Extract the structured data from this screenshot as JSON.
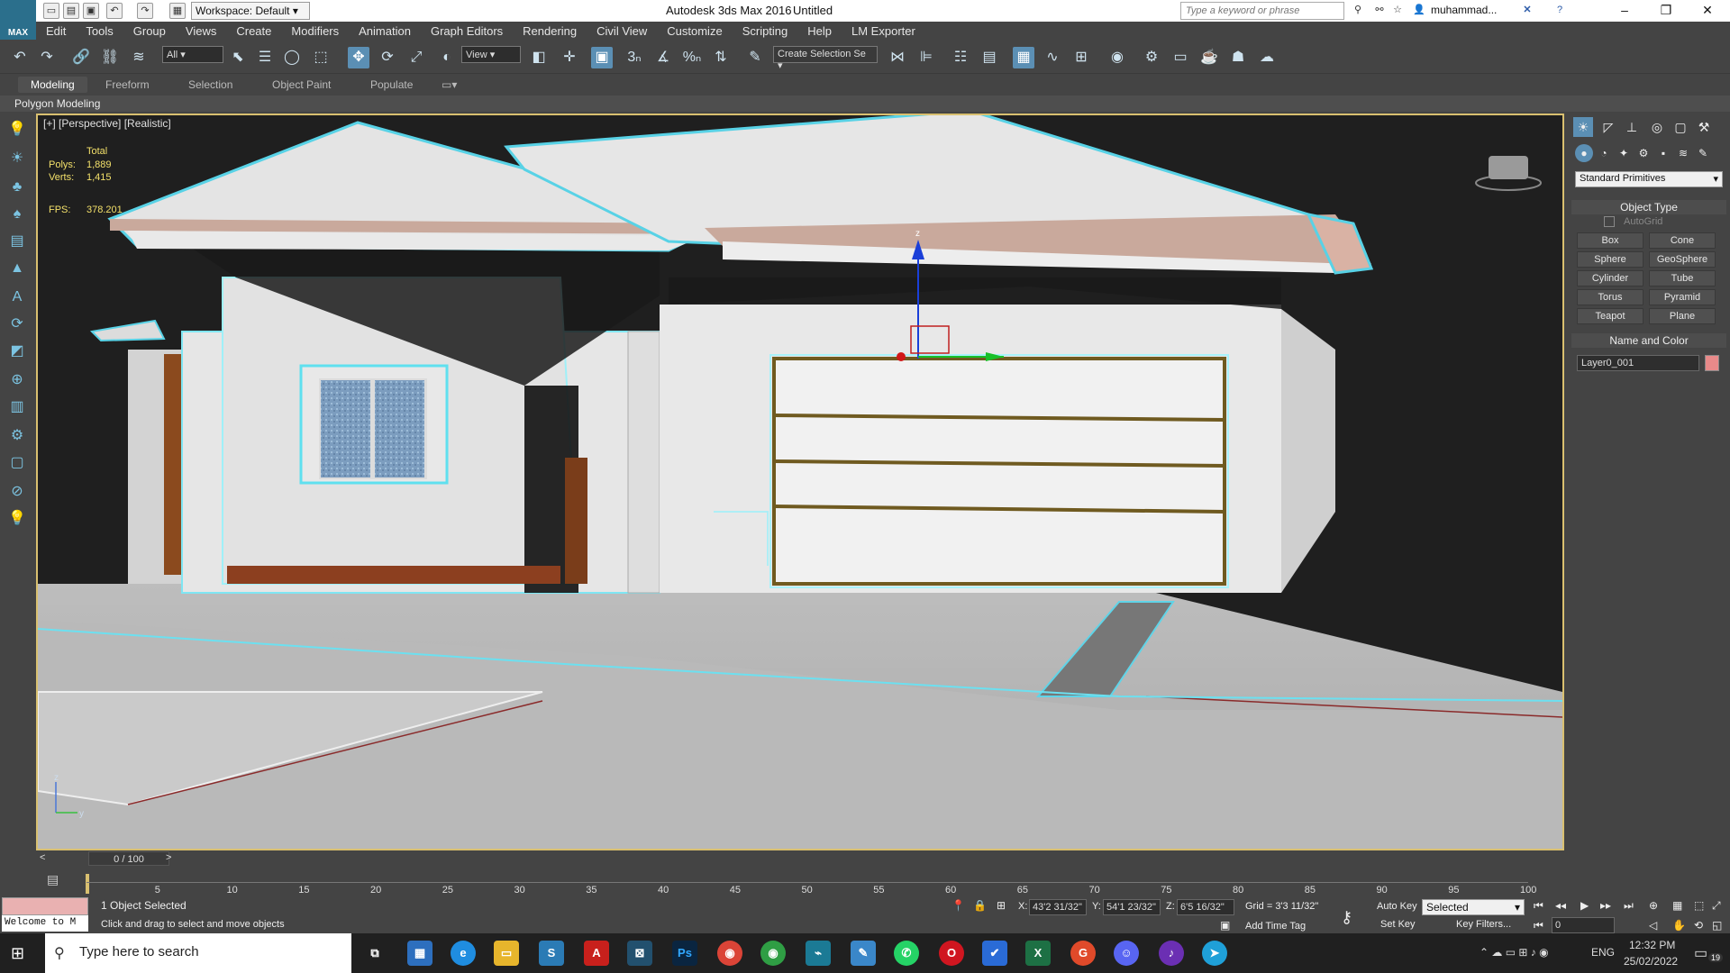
{
  "title_bar": {
    "logo_label": "MAX",
    "workspace": "Workspace: Default",
    "title": "Autodesk 3ds Max 2016",
    "doc": "Untitled",
    "search_placeholder": "Type a keyword or phrase",
    "user": "muhammad..."
  },
  "menu": [
    "Edit",
    "Tools",
    "Group",
    "Views",
    "Create",
    "Modifiers",
    "Animation",
    "Graph Editors",
    "Rendering",
    "Civil View",
    "Customize",
    "Scripting",
    "Help",
    "LM Exporter"
  ],
  "toolbar": {
    "filter": "All",
    "ref_coord": "View",
    "selection_set": "Create Selection Se",
    "snaps": [
      "3",
      "%"
    ]
  },
  "ribbon": {
    "tabs": [
      "Modeling",
      "Freeform",
      "Selection",
      "Object Paint",
      "Populate"
    ],
    "panel": "Polygon Modeling"
  },
  "viewport": {
    "label": "[+] [Perspective] [Realistic]",
    "stats": {
      "header": "Total",
      "polys_label": "Polys:",
      "polys": "1,889",
      "verts_label": "Verts:",
      "verts": "1,415",
      "fps_label": "FPS:",
      "fps": "378.201"
    },
    "gizmo_axis": "z",
    "tripod_y": "y",
    "tripod_z": "z"
  },
  "command_panel": {
    "dropdown": "Standard Primitives",
    "object_type_title": "Object Type",
    "autogrid": "AutoGrid",
    "buttons": [
      "Box",
      "Cone",
      "Sphere",
      "GeoSphere",
      "Cylinder",
      "Tube",
      "Torus",
      "Pyramid",
      "Teapot",
      "Plane"
    ],
    "name_color_title": "Name and Color",
    "object_name": "Layer0_001",
    "object_color": "#e88a8a"
  },
  "timeline": {
    "slider": "0 / 100",
    "ticks": [
      "5",
      "10",
      "15",
      "20",
      "25",
      "30",
      "35",
      "40",
      "45",
      "50",
      "55",
      "60",
      "65",
      "70",
      "75",
      "80",
      "85",
      "90",
      "95",
      "100"
    ]
  },
  "status": {
    "maxscript": "Welcome to M",
    "selected": "1 Object Selected",
    "prompt": "Click and drag to select and move objects",
    "x_label": "X:",
    "x": "43'2 31/32\"",
    "y_label": "Y:",
    "y": "54'1 23/32\"",
    "z_label": "Z:",
    "z": "6'5 16/32\"",
    "grid": "Grid = 3'3 11/32\"",
    "add_time_tag": "Add Time Tag",
    "auto_key": "Auto Key",
    "set_key": "Set Key",
    "key_mode": "Selected",
    "key_filters": "Key Filters...",
    "frame": "0"
  },
  "taskbar": {
    "search": "Type here to search",
    "lang": "ENG",
    "time": "12:32 PM",
    "date": "25/02/2022",
    "notif": "19"
  }
}
